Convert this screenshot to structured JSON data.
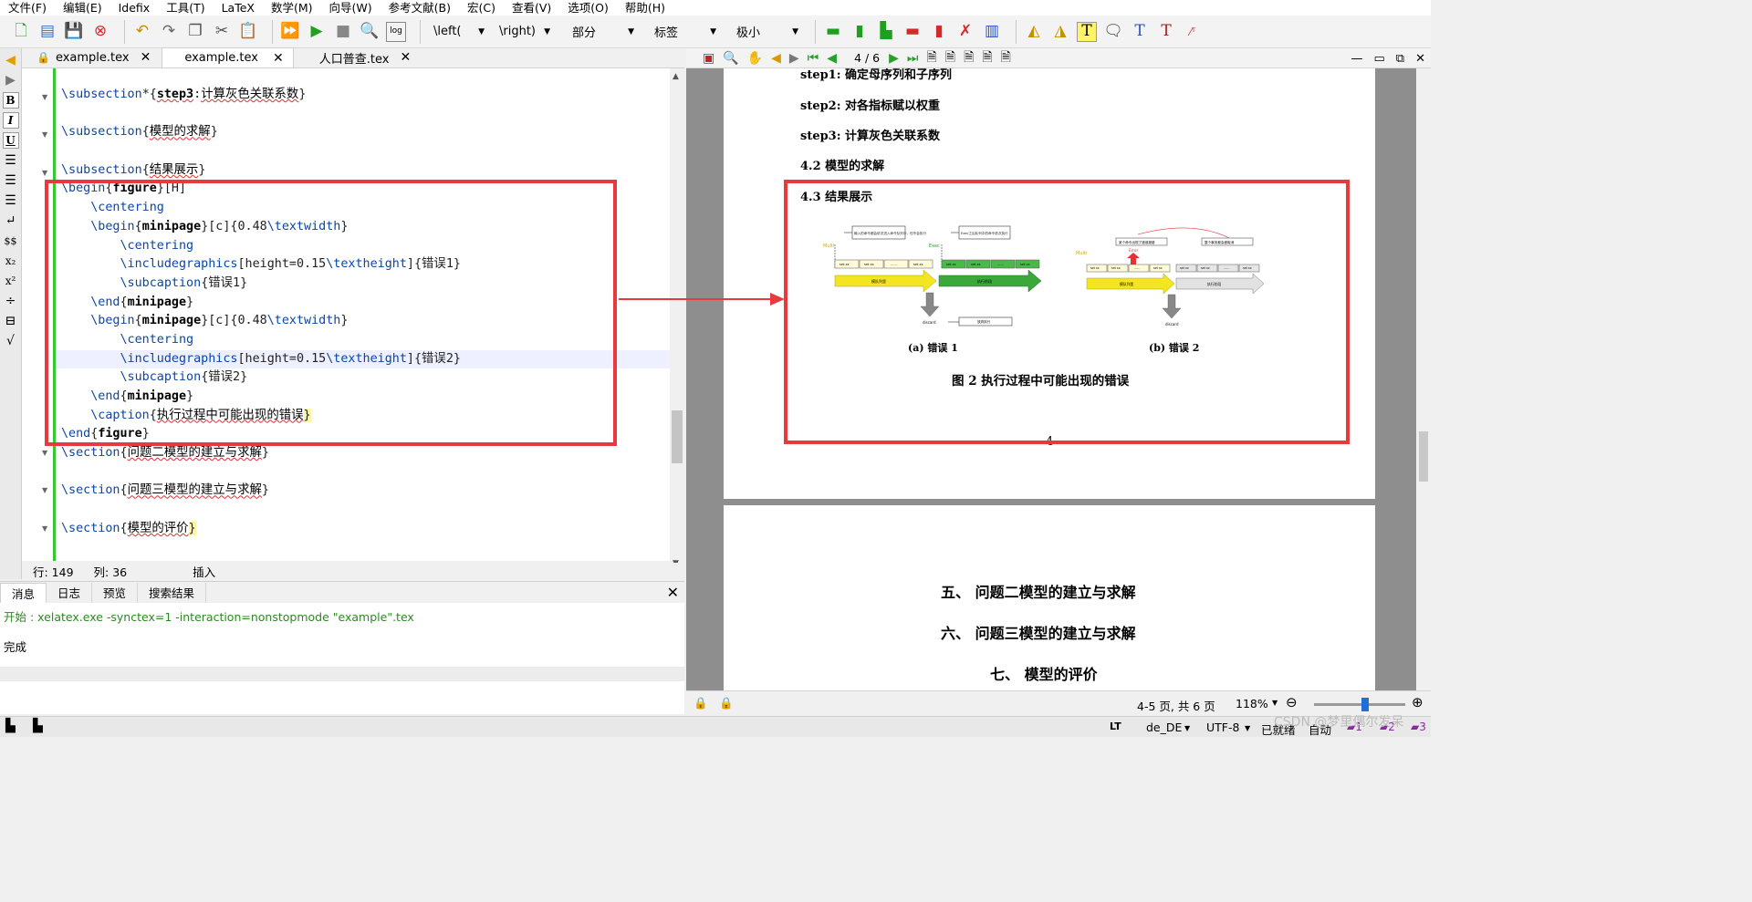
{
  "menu": [
    "文件(F)",
    "编辑(E)",
    "Idefix",
    "工具(T)",
    "LaTeX",
    "数学(M)",
    "向导(W)",
    "参考文献(B)",
    "宏(C)",
    "查看(V)",
    "选项(O)",
    "帮助(H)"
  ],
  "toolbar": {
    "combo_left": "\\left(",
    "combo_right": "\\right)",
    "combo_section": "部分",
    "combo_label": "标签",
    "combo_size": "极小"
  },
  "tabs": [
    {
      "label": "example.tex",
      "locked": true
    },
    {
      "label": "example.tex",
      "locked": false
    },
    {
      "label": "人口普查.tex",
      "locked": false
    }
  ],
  "editor": {
    "status": {
      "row": "行:  149",
      "col": "列:  36",
      "mode": "插入"
    }
  },
  "messages": {
    "tabs": [
      "消息",
      "日志",
      "预览",
      "搜索结果"
    ],
    "line1": "开始 : xelatex.exe -synctex=1 -interaction=nonstopmode \"example\".tex",
    "line2": "完成"
  },
  "pdf": {
    "page_indicator": "4 / 6",
    "step1": "step1: 确定母序列和子序列",
    "step2": "step2: 对各指标赋以权重",
    "step3": "step3: 计算灰色关联系数",
    "sub42": "4.2  模型的求解",
    "sub43": "4.3  结果展示",
    "subfig_a": "(a) 错误 1",
    "subfig_b": "(b) 错误 2",
    "caption": "图 2    执行过程中可能出现的错误",
    "page_number": "4",
    "sec5": "五、 问题二模型的建立与求解",
    "sec6": "六、 问题三模型的建立与求解",
    "sec7": "七、 模型的评价",
    "fig_a": {
      "multi": "Multi",
      "exec": "Exec",
      "discard": "discard",
      "box1": "输入的命令都会依次进入命令队列中，但不会执行",
      "box2": "Exec之后队列中的命令依次执行",
      "box3": "放弃执行",
      "set": "set xx",
      "dots": "……",
      "arrow1": "模队列里",
      "arrow2": "执行阶段"
    },
    "fig_b": {
      "multi": "Multi",
      "error": "Error",
      "discard": "discard",
      "box1": "某个命令出现了错误报错",
      "box2": "整个事务都会被取消",
      "set": "set xx",
      "dots": "……",
      "arrow1": "模队列里",
      "arrow2": "执行阶段"
    },
    "status": {
      "pages": "4-5 页, 共 6 页",
      "zoom": "118%"
    }
  },
  "bottom": {
    "lt": "LT",
    "lang": "de_DE",
    "encoding": "UTF-8",
    "state": "已就绪",
    "auto": "自动"
  },
  "watermark": "CSDN @梦里偶尔发呆",
  "colors": {
    "annotation_red": "#e8393c",
    "keyword_blue": "#0a46a8",
    "edit_green": "#34c834",
    "msg_green": "#2b8a1f"
  }
}
